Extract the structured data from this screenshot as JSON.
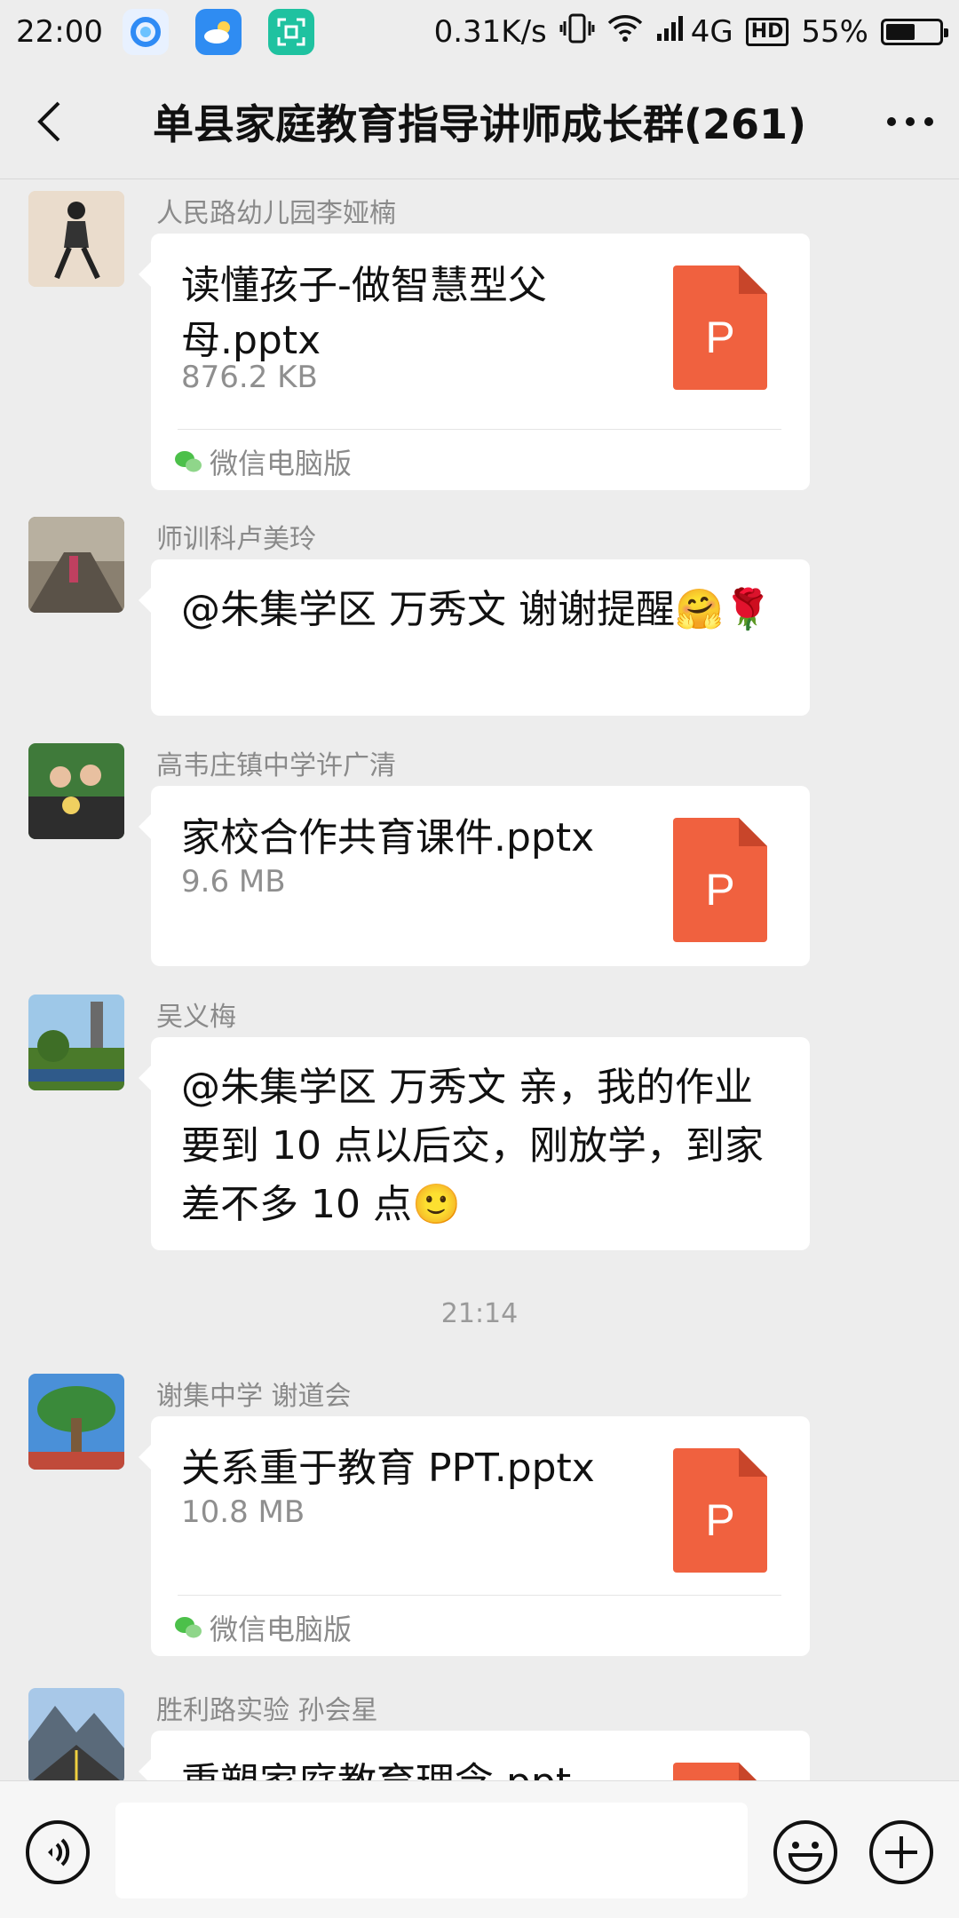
{
  "status_bar": {
    "time": "22:00",
    "network_speed": "0.31K/s",
    "network_type": "4G",
    "hd": "HD",
    "battery_percent": "55%",
    "battery_level": 0.55
  },
  "nav": {
    "title": "单县家庭教育指导讲师成长群(261)"
  },
  "messages": [
    {
      "sender": "人民路幼儿园李娅楠",
      "file_name": "读懂孩子-做智慧型父母.pptx",
      "file_size": "876.2 KB",
      "source": "微信电脑版",
      "file_badge": "P"
    },
    {
      "sender": "师训科卢美玲",
      "text": "@朱集学区  万秀文  谢谢提醒🤗🌹"
    },
    {
      "sender": "高韦庄镇中学许广清",
      "file_name": "家校合作共育课件.pptx",
      "file_size": "9.6 MB",
      "file_badge": "P"
    },
    {
      "sender": "吴义梅",
      "text": "@朱集学区  万秀文  亲，我的作业要到 10 点以后交，刚放学，到家差不多 10 点🙂"
    },
    {
      "sender": "谢集中学  谢道会",
      "file_name": "关系重于教育 PPT.pptx",
      "file_size": "10.8 MB",
      "source": "微信电脑版",
      "file_badge": "P"
    },
    {
      "sender": "胜利路实验  孙会星",
      "file_name": "重塑家庭教育理念.ppt",
      "file_badge": "P"
    }
  ],
  "time_divider": "21:14",
  "colors": {
    "background": "#ededed",
    "bubble": "#ffffff",
    "ppt_icon": "#f0613f",
    "wechat_green": "#4cc04a"
  },
  "icons": {
    "back": "chevron-left-icon",
    "more": "more-dots-icon",
    "voice": "voice-icon",
    "emoji": "emoji-icon",
    "plus": "plus-icon"
  }
}
